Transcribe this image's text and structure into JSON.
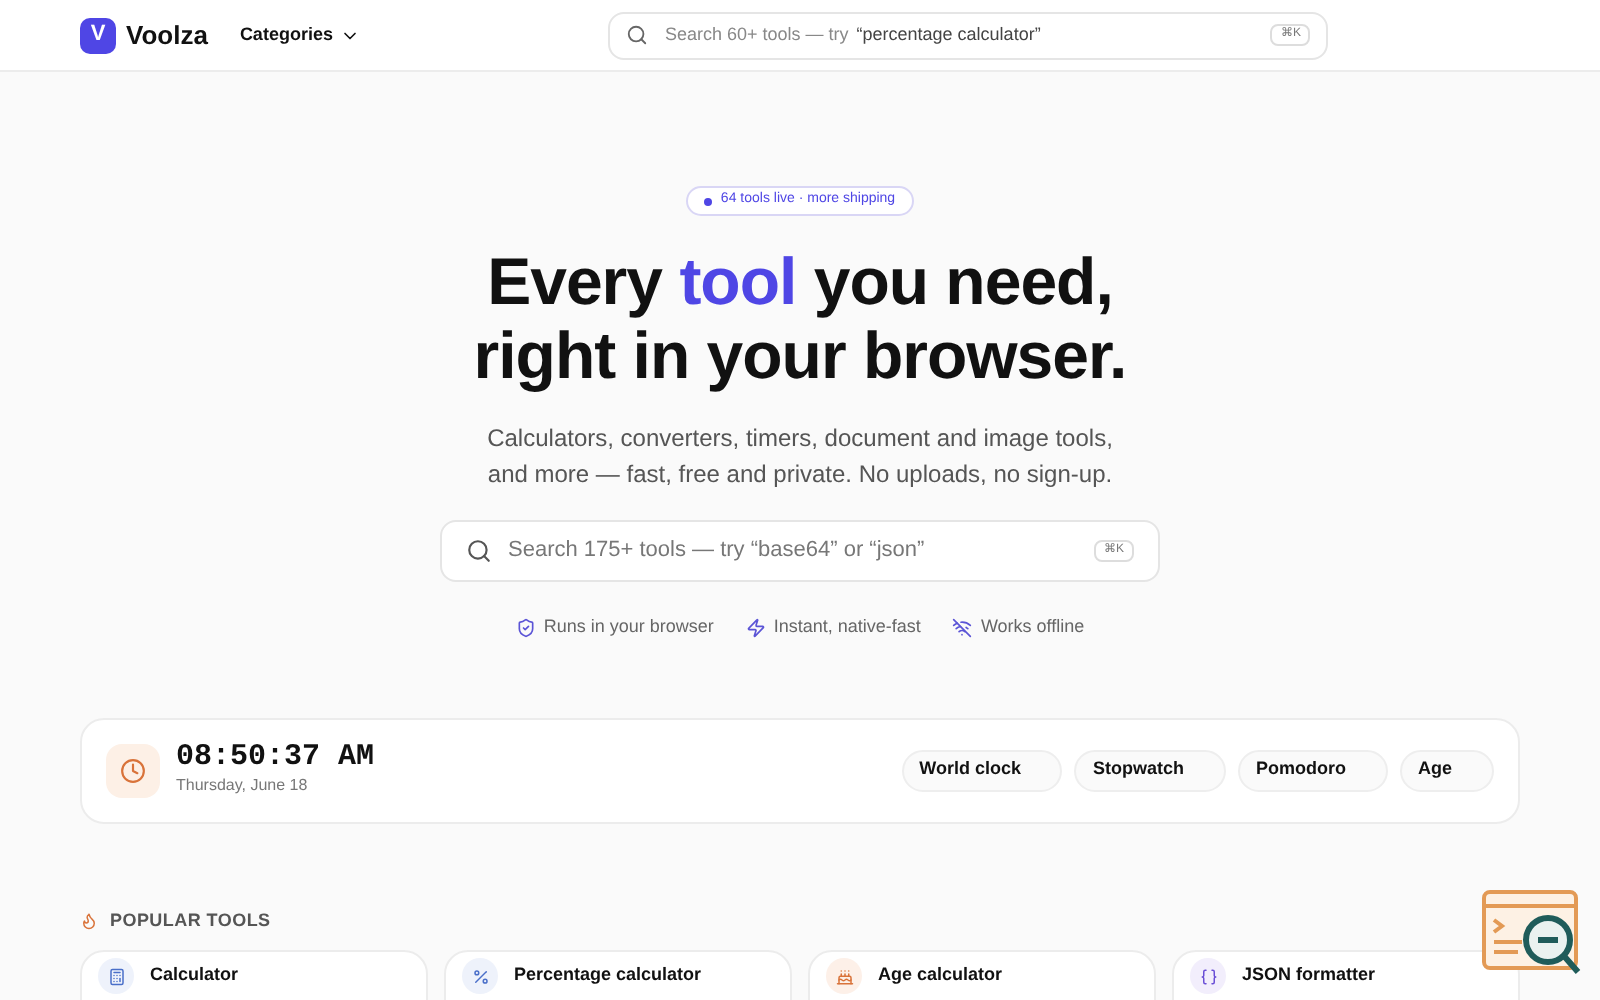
{
  "header": {
    "logo_letter": "V",
    "brand": "Voolza",
    "categories": "Categories",
    "search": {
      "placeholder": "Search 60+ tools — try",
      "hint": "“percentage calculator”",
      "shortcut": "⌘K"
    }
  },
  "hero": {
    "badge": "64 tools live · more shipping",
    "title_before": "Every",
    "title_accent": "tool",
    "title_after": "you need,",
    "title_line2": "right in your browser.",
    "subtitle": "Calculators, converters, timers, document and image tools, and more — fast, free and private. No uploads, no sign-up.",
    "search": {
      "placeholder": "Search 175+ tools — try “base64” or “json”",
      "shortcut": "⌘K"
    },
    "features": [
      {
        "kind": "shield",
        "label": "Runs in your browser"
      },
      {
        "kind": "bolt",
        "label": "Instant, native-fast"
      },
      {
        "kind": "offline",
        "label": "Works offline"
      }
    ]
  },
  "clock": {
    "time": "08:50:37 AM",
    "date": "Thursday, June 18",
    "links": [
      "World clock",
      "Stopwatch",
      "Pomodoro",
      "Age"
    ]
  },
  "popular": {
    "heading": "POPULAR TOOLS",
    "tools": [
      {
        "kind": "calculator",
        "name": "Calculator"
      },
      {
        "kind": "percent",
        "name": "Percentage calculator"
      },
      {
        "kind": "cake",
        "name": "Age calculator"
      },
      {
        "kind": "json",
        "name": "JSON formatter"
      }
    ]
  }
}
